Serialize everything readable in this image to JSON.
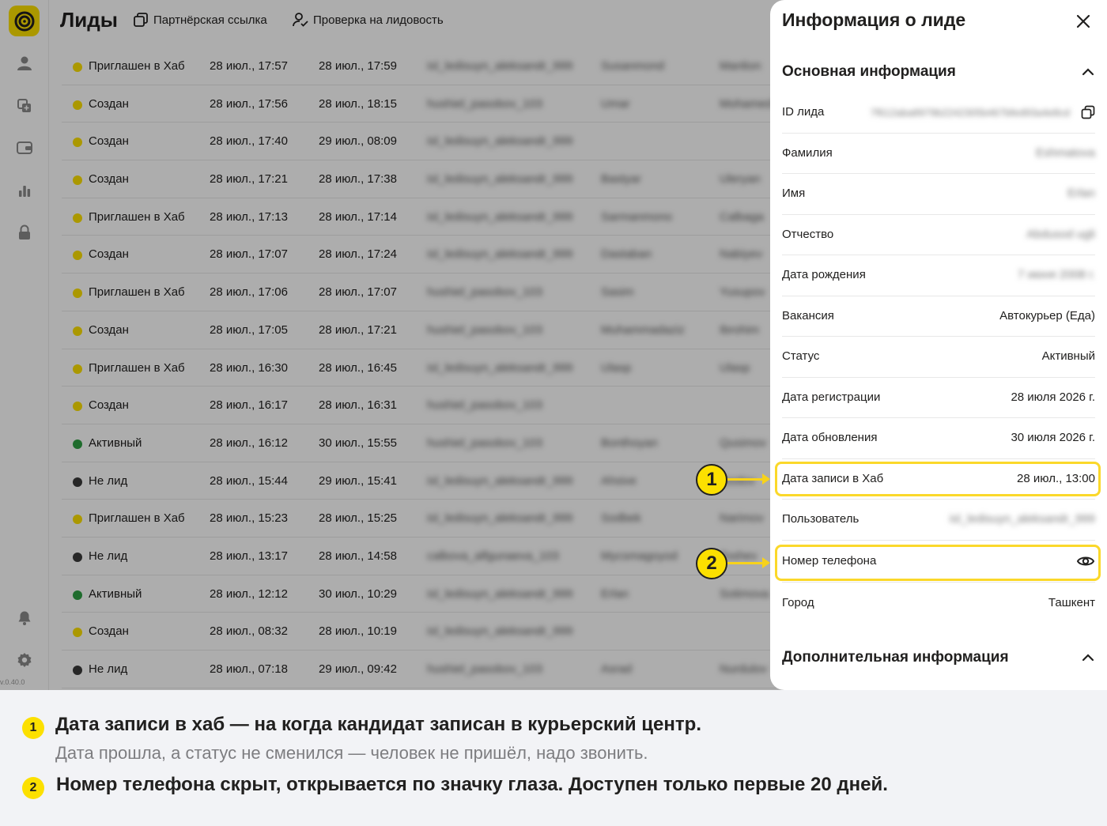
{
  "header": {
    "title": "Лиды",
    "partner_link": "Партнёрская ссылка",
    "lead_check": "Проверка на лидовость"
  },
  "sidebar": {
    "icons": [
      "user-icon",
      "copy-plus-icon",
      "wallet-icon",
      "bar-chart-icon",
      "lock-icon",
      "bell-icon",
      "gear-icon"
    ],
    "version": "v.0.40.0"
  },
  "colors": {
    "yellow": "#fce000",
    "green": "#2ea043",
    "dark": "#3a3a3a",
    "highlight": "#fbd82a"
  },
  "table": {
    "rows": [
      {
        "status": "Приглашен в Хаб",
        "dot": "yellow",
        "created": "28 июл., 17:57",
        "updated": "28 июл., 17:59",
        "user": "isl_ledisuyn_aleksandr_999",
        "name": "Susanmond",
        "surname": "Manlion"
      },
      {
        "status": "Создан",
        "dot": "yellow",
        "created": "28 июл., 17:56",
        "updated": "28 июл., 18:15",
        "user": "hushiel_pasobov_103",
        "name": "Umar",
        "surname": "Mohamed"
      },
      {
        "status": "Создан",
        "dot": "yellow",
        "created": "28 июл., 17:40",
        "updated": "29 июл., 08:09",
        "user": "isl_ledisuyn_aleksandr_999",
        "name": "",
        "surname": ""
      },
      {
        "status": "Создан",
        "dot": "yellow",
        "created": "28 июл., 17:21",
        "updated": "28 июл., 17:38",
        "user": "isl_ledisuyn_aleksandr_999",
        "name": "Bastyar",
        "surname": "Uleryan"
      },
      {
        "status": "Приглашен в Хаб",
        "dot": "yellow",
        "created": "28 июл., 17:13",
        "updated": "28 июл., 17:14",
        "user": "isl_ledisuyn_aleksandr_999",
        "name": "Sarmanmono",
        "surname": "Calbaga"
      },
      {
        "status": "Создан",
        "dot": "yellow",
        "created": "28 июл., 17:07",
        "updated": "28 июл., 17:24",
        "user": "isl_ledisuyn_aleksandr_999",
        "name": "Dastaban",
        "surname": "Nabiyev"
      },
      {
        "status": "Приглашен в Хаб",
        "dot": "yellow",
        "created": "28 июл., 17:06",
        "updated": "28 июл., 17:07",
        "user": "hushiel_pasobov_103",
        "name": "Sasim",
        "surname": "Yusupov"
      },
      {
        "status": "Создан",
        "dot": "yellow",
        "created": "28 июл., 17:05",
        "updated": "28 июл., 17:21",
        "user": "hushiel_pasobov_103",
        "name": "Muhammadaziz",
        "surname": "Ibrohim"
      },
      {
        "status": "Приглашен в Хаб",
        "dot": "yellow",
        "created": "28 июл., 16:30",
        "updated": "28 июл., 16:45",
        "user": "isl_ledisuyn_aleksandr_999",
        "name": "Ulasp",
        "surname": "Ulasp"
      },
      {
        "status": "Создан",
        "dot": "yellow",
        "created": "28 июл., 16:17",
        "updated": "28 июл., 16:31",
        "user": "hushiel_pasobov_103",
        "name": "",
        "surname": ""
      },
      {
        "status": "Активный",
        "dot": "green",
        "created": "28 июл., 16:12",
        "updated": "30 июл., 15:55",
        "user": "hushiel_pasobov_103",
        "name": "Bonthoyan",
        "surname": "Qusimov"
      },
      {
        "status": "Не лид",
        "dot": "dark",
        "created": "28 июл., 15:44",
        "updated": "29 июл., 15:41",
        "user": "isl_ledisuyn_aleksandr_999",
        "name": "Ahsive",
        "surname": "Ibodov"
      },
      {
        "status": "Приглашен в Хаб",
        "dot": "yellow",
        "created": "28 июл., 15:23",
        "updated": "28 июл., 15:25",
        "user": "isl_ledisuyn_aleksandr_999",
        "name": "Sodbek",
        "surname": "Narimov"
      },
      {
        "status": "Не лид",
        "dot": "dark",
        "created": "28 июл., 13:17",
        "updated": "28 июл., 14:58",
        "user": "calbova_alfgunaeva_103",
        "name": "Mycsmagoyod",
        "surname": "Toshev"
      },
      {
        "status": "Активный",
        "dot": "green",
        "created": "28 июл., 12:12",
        "updated": "30 июл., 10:29",
        "user": "isl_ledisuyn_aleksandr_999",
        "name": "Erlan",
        "surname": "Sotimova"
      },
      {
        "status": "Создан",
        "dot": "yellow",
        "created": "28 июл., 08:32",
        "updated": "28 июл., 10:19",
        "user": "isl_ledisuyn_aleksandr_999",
        "name": "",
        "surname": ""
      },
      {
        "status": "Не лид",
        "dot": "dark",
        "created": "28 июл., 07:18",
        "updated": "29 июл., 09:42",
        "user": "hushiel_pasobov_103",
        "name": "Asrad",
        "surname": "Nurdulov"
      }
    ]
  },
  "panel": {
    "title": "Информация о лиде",
    "main_section": "Основная информация",
    "extra_section": "Дополнительная информация",
    "fields": {
      "id": {
        "label": "ID лида",
        "value": "7f612aba8979b2242305b467bfed93a4e8cd"
      },
      "surname": {
        "label": "Фамилия",
        "value": "Eshmatova"
      },
      "name": {
        "label": "Имя",
        "value": "Erlan"
      },
      "patronymic": {
        "label": "Отчество",
        "value": "Abdusod ugli"
      },
      "birth": {
        "label": "Дата рождения",
        "value": "7 июня 2008 г."
      },
      "vacancy": {
        "label": "Вакансия",
        "value": "Автокурьер (Еда)"
      },
      "status": {
        "label": "Статус",
        "value": "Активный"
      },
      "reg_date": {
        "label": "Дата регистрации",
        "value": "28 июля 2026 г."
      },
      "upd_date": {
        "label": "Дата обновления",
        "value": "30 июля 2026 г."
      },
      "hub_date": {
        "label": "Дата записи в Хаб",
        "value": "28 июл., 13:00"
      },
      "user": {
        "label": "Пользователь",
        "value": "isl_ledisuyn_aleksandr_999"
      },
      "phone": {
        "label": "Номер телефона"
      },
      "city": {
        "label": "Город",
        "value": "Ташкент"
      }
    }
  },
  "callouts": {
    "n1": "1",
    "n2": "2"
  },
  "caption": {
    "item1_num": "1",
    "item1_title": "Дата записи в хаб — на когда кандидат записан в курьерский центр.",
    "item1_sub": "Дата прошла, а статус не сменился — человек не пришёл, надо звонить.",
    "item2_num": "2",
    "item2_title": "Номер телефона скрыт, открывается по значку глаза. Доступен только первые 20 дней."
  }
}
